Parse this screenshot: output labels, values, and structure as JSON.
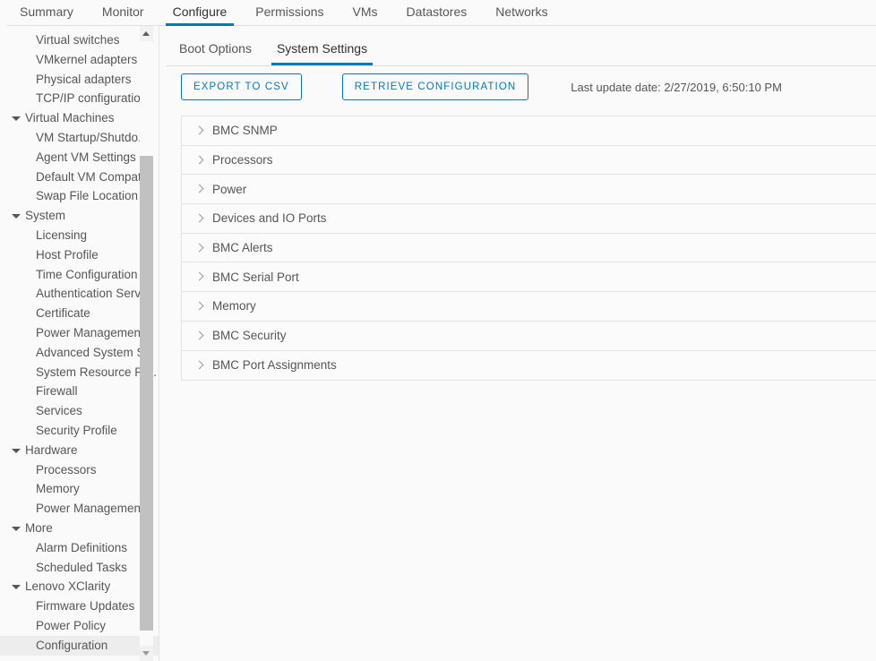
{
  "top_tabs": [
    {
      "label": "Summary",
      "active": false
    },
    {
      "label": "Monitor",
      "active": false
    },
    {
      "label": "Configure",
      "active": true
    },
    {
      "label": "Permissions",
      "active": false
    },
    {
      "label": "VMs",
      "active": false
    },
    {
      "label": "Datastores",
      "active": false
    },
    {
      "label": "Networks",
      "active": false
    }
  ],
  "sidebar": {
    "items": [
      {
        "label": "Virtual switches",
        "type": "leaf",
        "selected": false
      },
      {
        "label": "VMkernel adapters",
        "type": "leaf",
        "selected": false
      },
      {
        "label": "Physical adapters",
        "type": "leaf",
        "selected": false
      },
      {
        "label": "TCP/IP configuration",
        "type": "leaf",
        "selected": false
      },
      {
        "label": "Virtual Machines",
        "type": "group",
        "selected": false
      },
      {
        "label": "VM Startup/Shutdo...",
        "type": "leaf",
        "selected": false
      },
      {
        "label": "Agent VM Settings",
        "type": "leaf",
        "selected": false
      },
      {
        "label": "Default VM Compati..",
        "type": "leaf",
        "selected": false
      },
      {
        "label": "Swap File Location",
        "type": "leaf",
        "selected": false
      },
      {
        "label": "System",
        "type": "group",
        "selected": false
      },
      {
        "label": "Licensing",
        "type": "leaf",
        "selected": false
      },
      {
        "label": "Host Profile",
        "type": "leaf",
        "selected": false
      },
      {
        "label": "Time Configuration",
        "type": "leaf",
        "selected": false
      },
      {
        "label": "Authentication Servi..",
        "type": "leaf",
        "selected": false
      },
      {
        "label": "Certificate",
        "type": "leaf",
        "selected": false
      },
      {
        "label": "Power Management",
        "type": "leaf",
        "selected": false
      },
      {
        "label": "Advanced System S..",
        "type": "leaf",
        "selected": false
      },
      {
        "label": "System Resource Re..",
        "type": "leaf",
        "selected": false
      },
      {
        "label": "Firewall",
        "type": "leaf",
        "selected": false
      },
      {
        "label": "Services",
        "type": "leaf",
        "selected": false
      },
      {
        "label": "Security Profile",
        "type": "leaf",
        "selected": false
      },
      {
        "label": "Hardware",
        "type": "group",
        "selected": false
      },
      {
        "label": "Processors",
        "type": "leaf",
        "selected": false
      },
      {
        "label": "Memory",
        "type": "leaf",
        "selected": false
      },
      {
        "label": "Power Management",
        "type": "leaf",
        "selected": false
      },
      {
        "label": "More",
        "type": "group",
        "selected": false
      },
      {
        "label": "Alarm Definitions",
        "type": "leaf",
        "selected": false
      },
      {
        "label": "Scheduled Tasks",
        "type": "leaf",
        "selected": false
      },
      {
        "label": "Lenovo XClarity",
        "type": "group",
        "selected": false
      },
      {
        "label": "Firmware Updates",
        "type": "leaf",
        "selected": false
      },
      {
        "label": "Power Policy",
        "type": "leaf",
        "selected": false
      },
      {
        "label": "Configuration",
        "type": "leaf",
        "selected": true
      }
    ],
    "scrollbar": {
      "up_arrow_icon": "caret-up-icon",
      "down_arrow_icon": "caret-down-icon"
    }
  },
  "main": {
    "sub_tabs": [
      {
        "label": "Boot Options",
        "active": false
      },
      {
        "label": "System Settings",
        "active": true
      }
    ],
    "actions": {
      "export_label": "EXPORT TO CSV",
      "retrieve_label": "RETRIEVE CONFIGURATION",
      "last_update": "Last update date: 2/27/2019, 6:50:10 PM"
    },
    "accordion": [
      {
        "label": "BMC SNMP",
        "expanded": false
      },
      {
        "label": "Processors",
        "expanded": false
      },
      {
        "label": "Power",
        "expanded": false
      },
      {
        "label": "Devices and IO Ports",
        "expanded": false
      },
      {
        "label": "BMC Alerts",
        "expanded": false
      },
      {
        "label": "BMC Serial Port",
        "expanded": false
      },
      {
        "label": "Memory",
        "expanded": false
      },
      {
        "label": "BMC Security",
        "expanded": false
      },
      {
        "label": "BMC Port Assignments",
        "expanded": false
      }
    ]
  },
  "colors": {
    "accent": "#0079b8",
    "text": "#565656",
    "page_bg": "#fafafa",
    "row_bg": "#fbfbfb",
    "border": "#e3e3e3",
    "selected_bg": "#ededed",
    "scrollbar_thumb": "#c1c1c1"
  }
}
